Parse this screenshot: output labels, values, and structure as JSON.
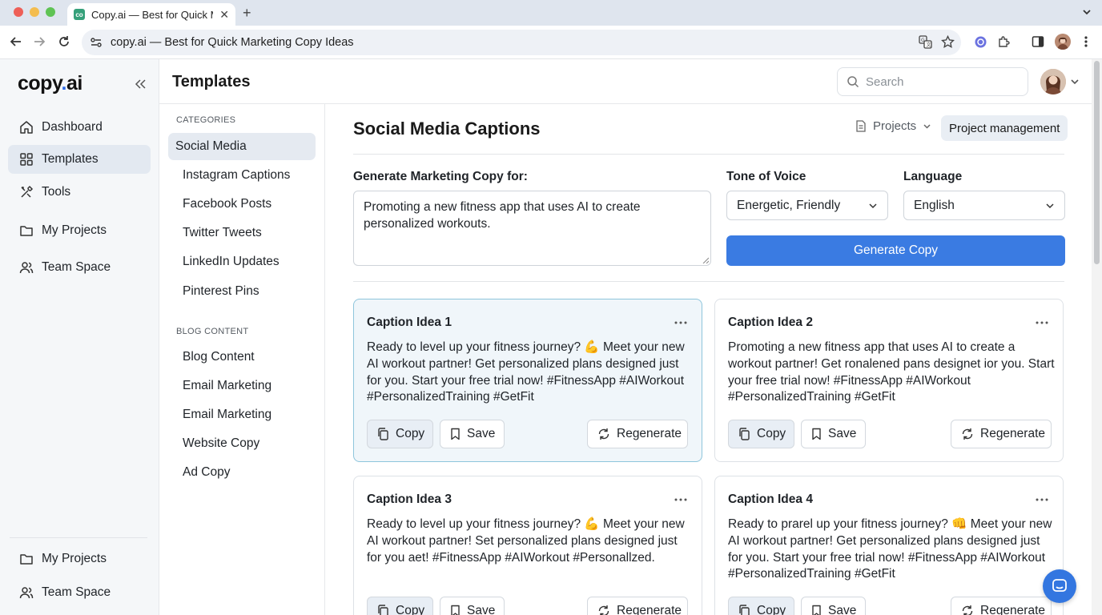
{
  "browser": {
    "tab_title": "Copy.ai — Best for Quick M",
    "favicon_text": "co",
    "url": "copy.ai — Best for Quick Marketing Copy Ideas"
  },
  "app": {
    "logo_text": "copy",
    "logo_dot": ".",
    "logo_suffix": "ai",
    "accent_color": "#3a7be2"
  },
  "sidebar": {
    "items": [
      {
        "label": "Dashboard",
        "icon": "home-icon"
      },
      {
        "label": "Templates",
        "icon": "grid-icon",
        "active": true
      },
      {
        "label": "Tools",
        "icon": "tools-icon"
      },
      {
        "label": "My Projects",
        "icon": "folder-icon"
      },
      {
        "label": "Team Space",
        "icon": "users-icon"
      }
    ],
    "bottom_items": [
      {
        "label": "My Projects",
        "icon": "folder-icon"
      },
      {
        "label": "Team Space",
        "icon": "users-icon"
      }
    ]
  },
  "header": {
    "title": "Templates",
    "search_placeholder": "Search"
  },
  "categories": {
    "heading1": "CATEGORIES",
    "group1": [
      "Social Media",
      "Instagram Captions",
      "Facebook Posts",
      "Twitter Tweets",
      "LinkedIn Updates",
      "Pinterest Pins"
    ],
    "heading2": "BLOG CONTENT",
    "group2": [
      "Blog Content",
      "Email Marketing",
      "Email Marketing",
      "Website Copy",
      "Ad Copy"
    ]
  },
  "main": {
    "title": "Social Media Captions",
    "projects_label": "Projects",
    "pm_label": "Project management",
    "prompt_label": "Generate Marketing Copy for:",
    "prompt_value": "Promoting a new fitness app that uses AI to create personalized workouts.",
    "tone_label": "Tone of Voice",
    "tone_value": "Energetic, Friendly",
    "language_label": "Language",
    "language_value": "English",
    "generate_label": "Generate Copy"
  },
  "cards": [
    {
      "title": "Caption Idea 1",
      "text": "Ready to level up your fitness journey? 💪 Meet your new AI workout partner! Get personalized plans designed just for you. Start your free trial now! #FitnessApp #AIWorkout #PersonalizedTraining #GetFit",
      "copy": "Copy",
      "save": "Save",
      "regen": "Regenerate"
    },
    {
      "title": "Caption Idea 2",
      "text": "Promoting a new fitness app that uses AI to create a workout partner! Get ronalened pans designet ior you. Start your free trial now! #FitnessApp #AIWorkout #PersonalizedTraining #GetFit",
      "copy": "Copy",
      "save": "Save",
      "regen": "Regenerate"
    },
    {
      "title": "Caption Idea 3",
      "text": "Ready to level up your fitness journey? 💪 Meet your new AI workout partner! Set personalized plans designed just for you aet! #FitnessApp #AIWorkout #Personallzed.",
      "copy": "Copy",
      "save": "Save",
      "regen": "Regenerate"
    },
    {
      "title": "Caption Idea 4",
      "text": "Ready to prarel up your fitness journey? 👊 Meet your new AI workout partner! Get personalized plans designed just for you. Start your free trial now! #FitnessApp #AIWorkout #PersonalizedTraining #GetFit",
      "copy": "Copy",
      "save": "Save",
      "regen": "Regenerate"
    }
  ]
}
